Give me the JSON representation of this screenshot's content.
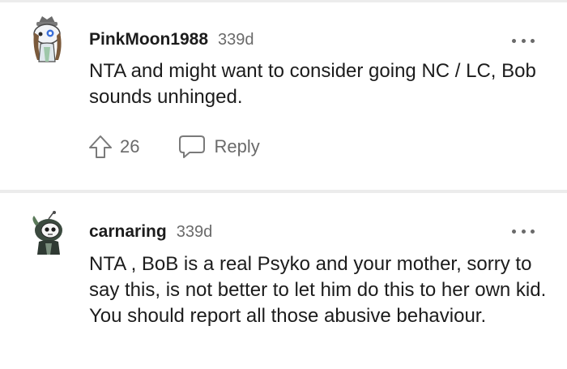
{
  "comments": [
    {
      "username": "PinkMoon1988",
      "age": "339d",
      "body": "NTA and might want to consider going NC / LC, Bob sounds unhinged.",
      "upvotes": "26",
      "reply_label": "Reply",
      "avatar_icon": "snoo-avatar-cat-hat",
      "more_icon": "more-options-icon"
    },
    {
      "username": "carnaring",
      "age": "339d",
      "body": "NTA , BoB is a real Psyko and your mother, sorry to say this, is not better to let him do this to her own kid. You should report all those abusive behaviour.",
      "avatar_icon": "snoo-avatar-skull-mask",
      "more_icon": "more-options-icon"
    }
  ],
  "colors": {
    "text_primary": "#1c1c1c",
    "text_secondary": "#6a6a6a",
    "divider": "#ececec",
    "background": "#ffffff"
  }
}
